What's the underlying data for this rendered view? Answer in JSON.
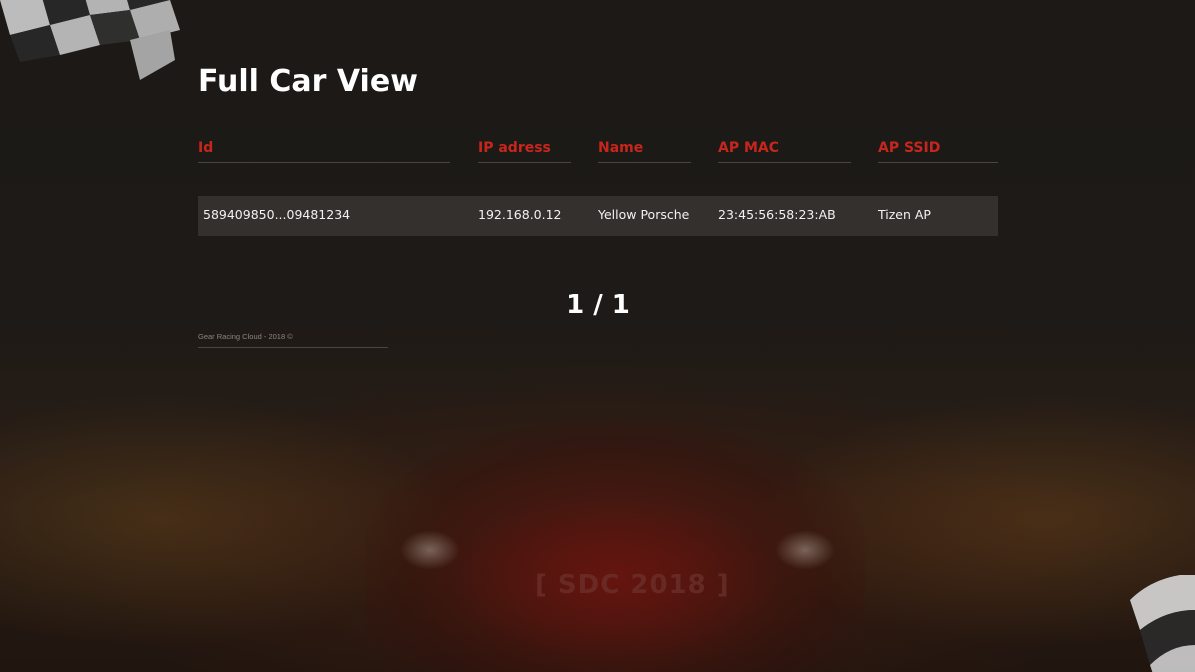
{
  "page": {
    "title": "Full Car View"
  },
  "table": {
    "columns": [
      "Id",
      "IP adress",
      "Name",
      "AP MAC",
      "AP SSID"
    ],
    "rows": [
      {
        "id": "589409850...09481234",
        "ip": "192.168.0.12",
        "name": "Yellow Porsche",
        "ap_mac": "23:45:56:58:23:AB",
        "ap_ssid": "Tizen AP"
      }
    ]
  },
  "pagination": {
    "label": "1 / 1"
  },
  "footer": {
    "text": "Gear Racing Cloud - 2018 ©"
  },
  "background": {
    "plate_text": "[ SDC 2018 ]"
  },
  "colors": {
    "accent": "#c8261c",
    "background": "#1a1614",
    "row_background": "#3c3835",
    "title": "#ffffff"
  }
}
